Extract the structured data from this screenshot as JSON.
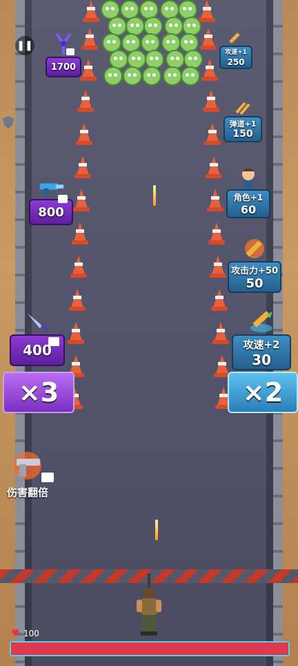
{
  "hud": {
    "pause_icon": "pause-icon",
    "shield_icon": "shield-icon",
    "hp_value": "100",
    "hp_fraction": 1.0
  },
  "pickups": {
    "left": [
      {
        "id": "crossbow",
        "icon": "crossbow-icon",
        "value": "1700",
        "color": "#7b2fc1",
        "has_video": true
      },
      {
        "id": "laser-gun",
        "icon": "laser-gun-icon",
        "value": "800",
        "color": "#7b2fc1",
        "has_video": true
      },
      {
        "id": "dagger",
        "icon": "dagger-icon",
        "value": "400",
        "color": "#7b2fc1",
        "has_video": true
      },
      {
        "id": "pistol",
        "icon": "pistol-icon",
        "label": "伤害翻倍",
        "has_video": true
      }
    ],
    "right": [
      {
        "id": "attack-speed-1",
        "icon": "bullets-icon",
        "label": "攻速+1",
        "value": "250"
      },
      {
        "id": "projectile-1",
        "icon": "bullets-icon",
        "label": "弹道+1",
        "value": "150"
      },
      {
        "id": "character-1",
        "icon": "character-icon",
        "label": "角色+1",
        "value": "60"
      },
      {
        "id": "attack-50",
        "icon": "bullet-burst-icon",
        "label": "攻击力+50",
        "value": "50"
      },
      {
        "id": "attack-speed-2",
        "icon": "bullet-icon",
        "label": "攻速+2",
        "value": "30"
      }
    ]
  },
  "multipliers": {
    "left": "×3",
    "right": "×2",
    "left_color": "#9b45d9",
    "right_color": "#3fa3dc"
  }
}
